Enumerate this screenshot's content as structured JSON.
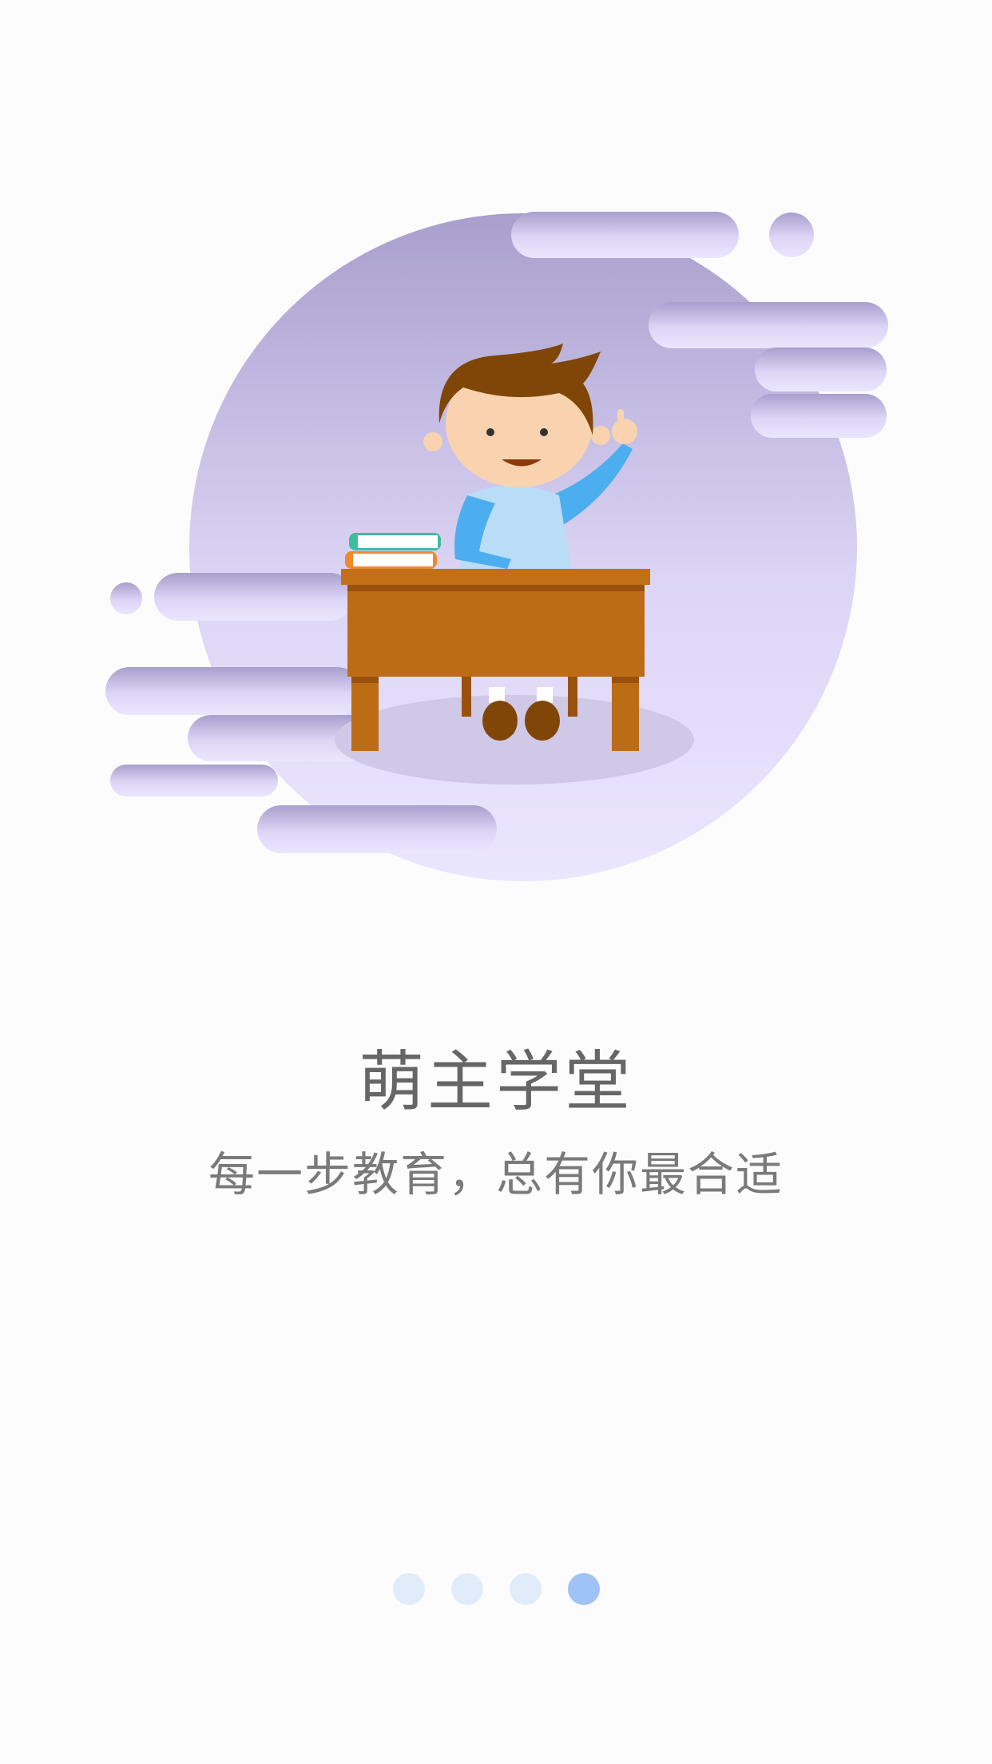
{
  "app": {
    "title": "萌主学堂",
    "tagline": "每一步教育，总有你最合适"
  },
  "pager": {
    "total": 4,
    "active_index": 3
  },
  "colors": {
    "background": "#fcfcfc",
    "blob_top": "#a89fcd",
    "blob_bottom": "#ebe6ff",
    "desk": "#bd6c16",
    "shirt": "#4daeef",
    "dot_inactive": "#e1ecfb",
    "dot_active": "#9fc3f5",
    "text": "#666666"
  },
  "illustration": {
    "subject": "boy-raising-hand-at-desk",
    "icons": [
      "student-icon",
      "desk-icon",
      "books-icon"
    ]
  }
}
